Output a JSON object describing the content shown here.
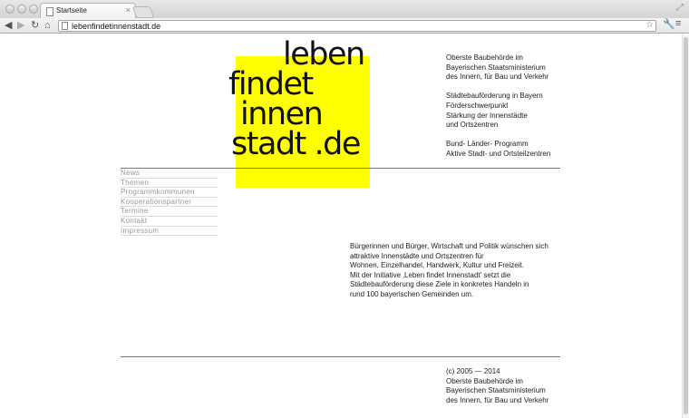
{
  "browser": {
    "tab_title": "Startseite",
    "tab_close": "×",
    "url": "lebenfindetinnenstadt.de",
    "icons": {
      "back": "◀",
      "forward": "▶",
      "reload": "↻",
      "home": "⌂",
      "star": "☆",
      "wrench": "🔧",
      "menu": "≡",
      "fullscreen": "⤢"
    }
  },
  "logo": {
    "lines": [
      "leben",
      "findet",
      "innen",
      "stadt .de"
    ],
    "accent_color": "#ffff00"
  },
  "header_info": {
    "groups": [
      [
        "Oberste Baubehörde im",
        "Bayerischen Staatsministerium",
        "des Innern, für Bau und Verkehr"
      ],
      [
        "Städtebauförderung in Bayern",
        "Förderschwerpunkt",
        "Stärkung der Innenstädte",
        "und Ortszentren"
      ],
      [
        "Bund- Länder- Programm",
        "Aktive Stadt- und Ortsteilzentren"
      ]
    ]
  },
  "nav": {
    "items": [
      "News",
      "Themen",
      "Programmkommunen",
      "Kooperationspartner",
      "Termine",
      "Kontakt",
      "Impressum"
    ]
  },
  "intro": {
    "lines": [
      "Bürgerinnen und Bürger, Wirtschaft und Politik wünschen sich",
      "attraktive Innenstädte und Ortszentren für",
      "Wohnen, Einzelhandel, Handwerk, Kultur und Freizeit.",
      "Mit der Initiative ‚Leben findet Innenstadt' setzt die",
      "Städtebauförderung diese Ziele in konkretes Handeln in",
      "rund 100 bayerischen Gemeinden um."
    ]
  },
  "footer": {
    "lines": [
      "(c) 2005 — 2014",
      "Oberste Baubehörde im",
      "Bayerischen Staatsministerium",
      "des Innern, für Bau und Verkehr"
    ]
  }
}
